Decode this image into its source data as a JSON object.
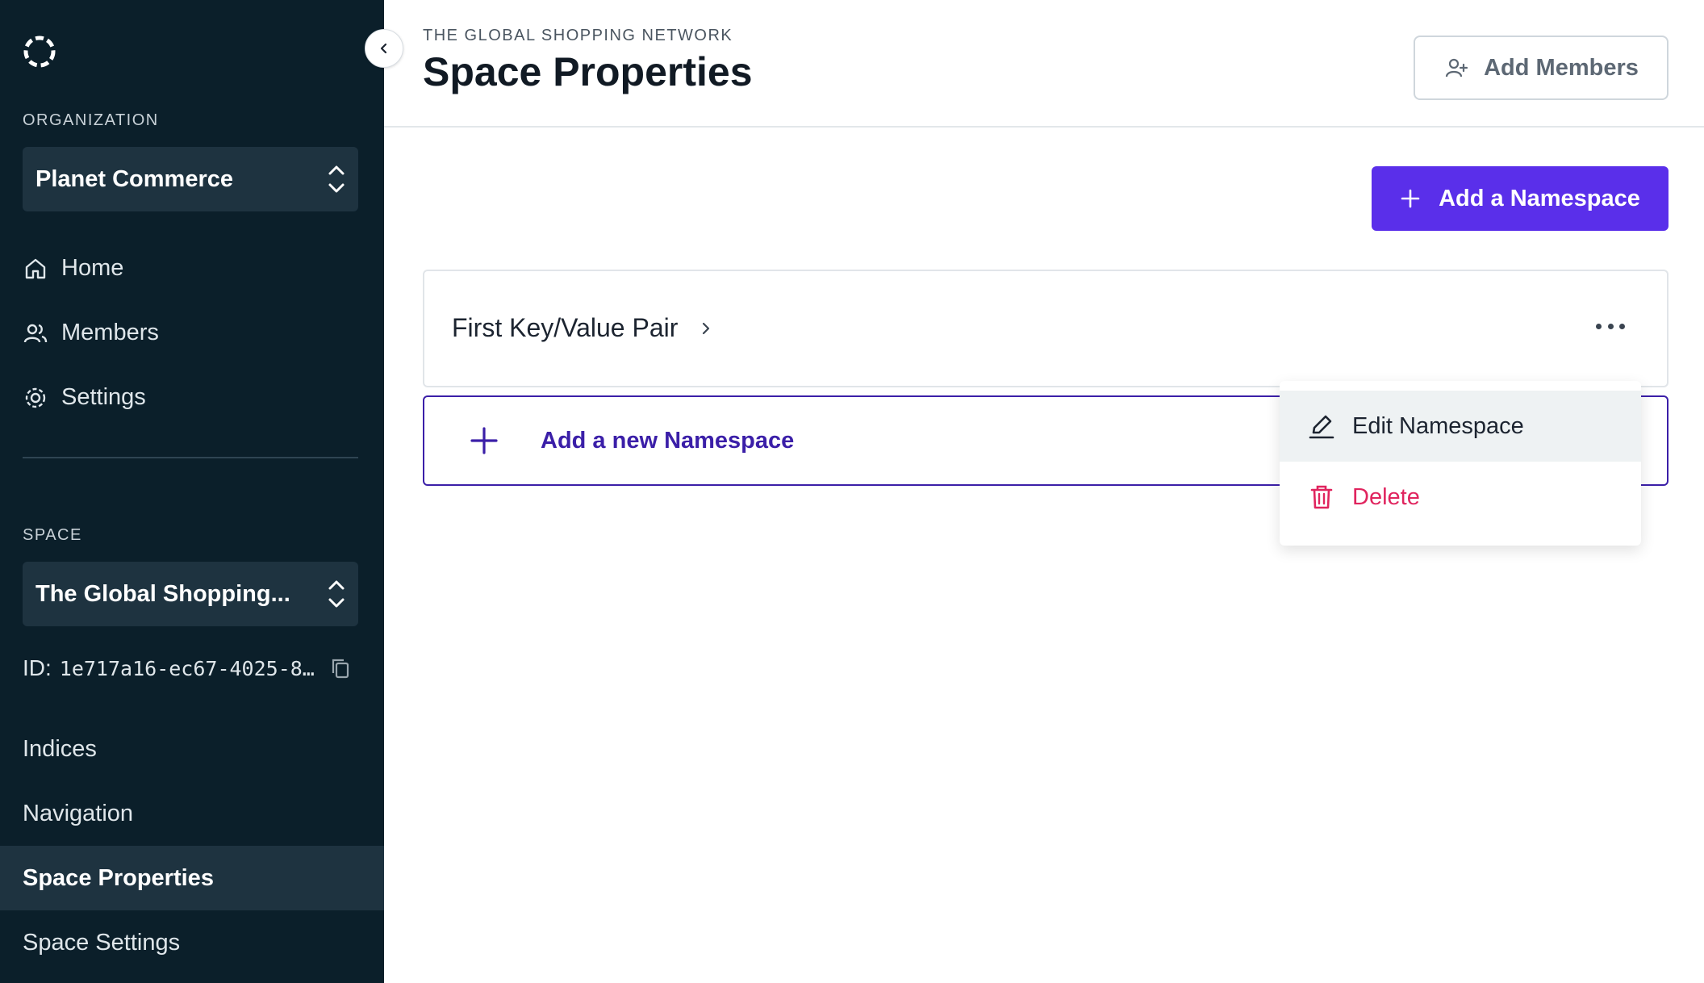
{
  "sidebar": {
    "org_label": "ORGANIZATION",
    "org_name": "Planet Commerce",
    "nav": [
      {
        "label": "Home",
        "icon": "home-icon"
      },
      {
        "label": "Members",
        "icon": "members-icon"
      },
      {
        "label": "Settings",
        "icon": "gear-icon"
      }
    ],
    "space_label": "SPACE",
    "space_name": "The Global Shopping...",
    "id_label": "ID:",
    "id_value": "1e717a16-ec67-4025-8…",
    "space_nav": [
      {
        "label": "Indices"
      },
      {
        "label": "Navigation"
      },
      {
        "label": "Space Properties"
      },
      {
        "label": "Space Settings"
      }
    ]
  },
  "header": {
    "breadcrumb": "THE GLOBAL SHOPPING NETWORK",
    "title": "Space Properties",
    "add_members_label": "Add Members"
  },
  "main": {
    "add_namespace_label": "Add a Namespace",
    "namespaces": [
      {
        "title": "First Key/Value Pair"
      }
    ],
    "add_new_label": "Add a new Namespace"
  },
  "menu": {
    "edit_label": "Edit Namespace",
    "delete_label": "Delete"
  },
  "colors": {
    "sidebar_bg": "#0b1f2a",
    "primary": "#5a2fea",
    "danger": "#e0245e"
  }
}
